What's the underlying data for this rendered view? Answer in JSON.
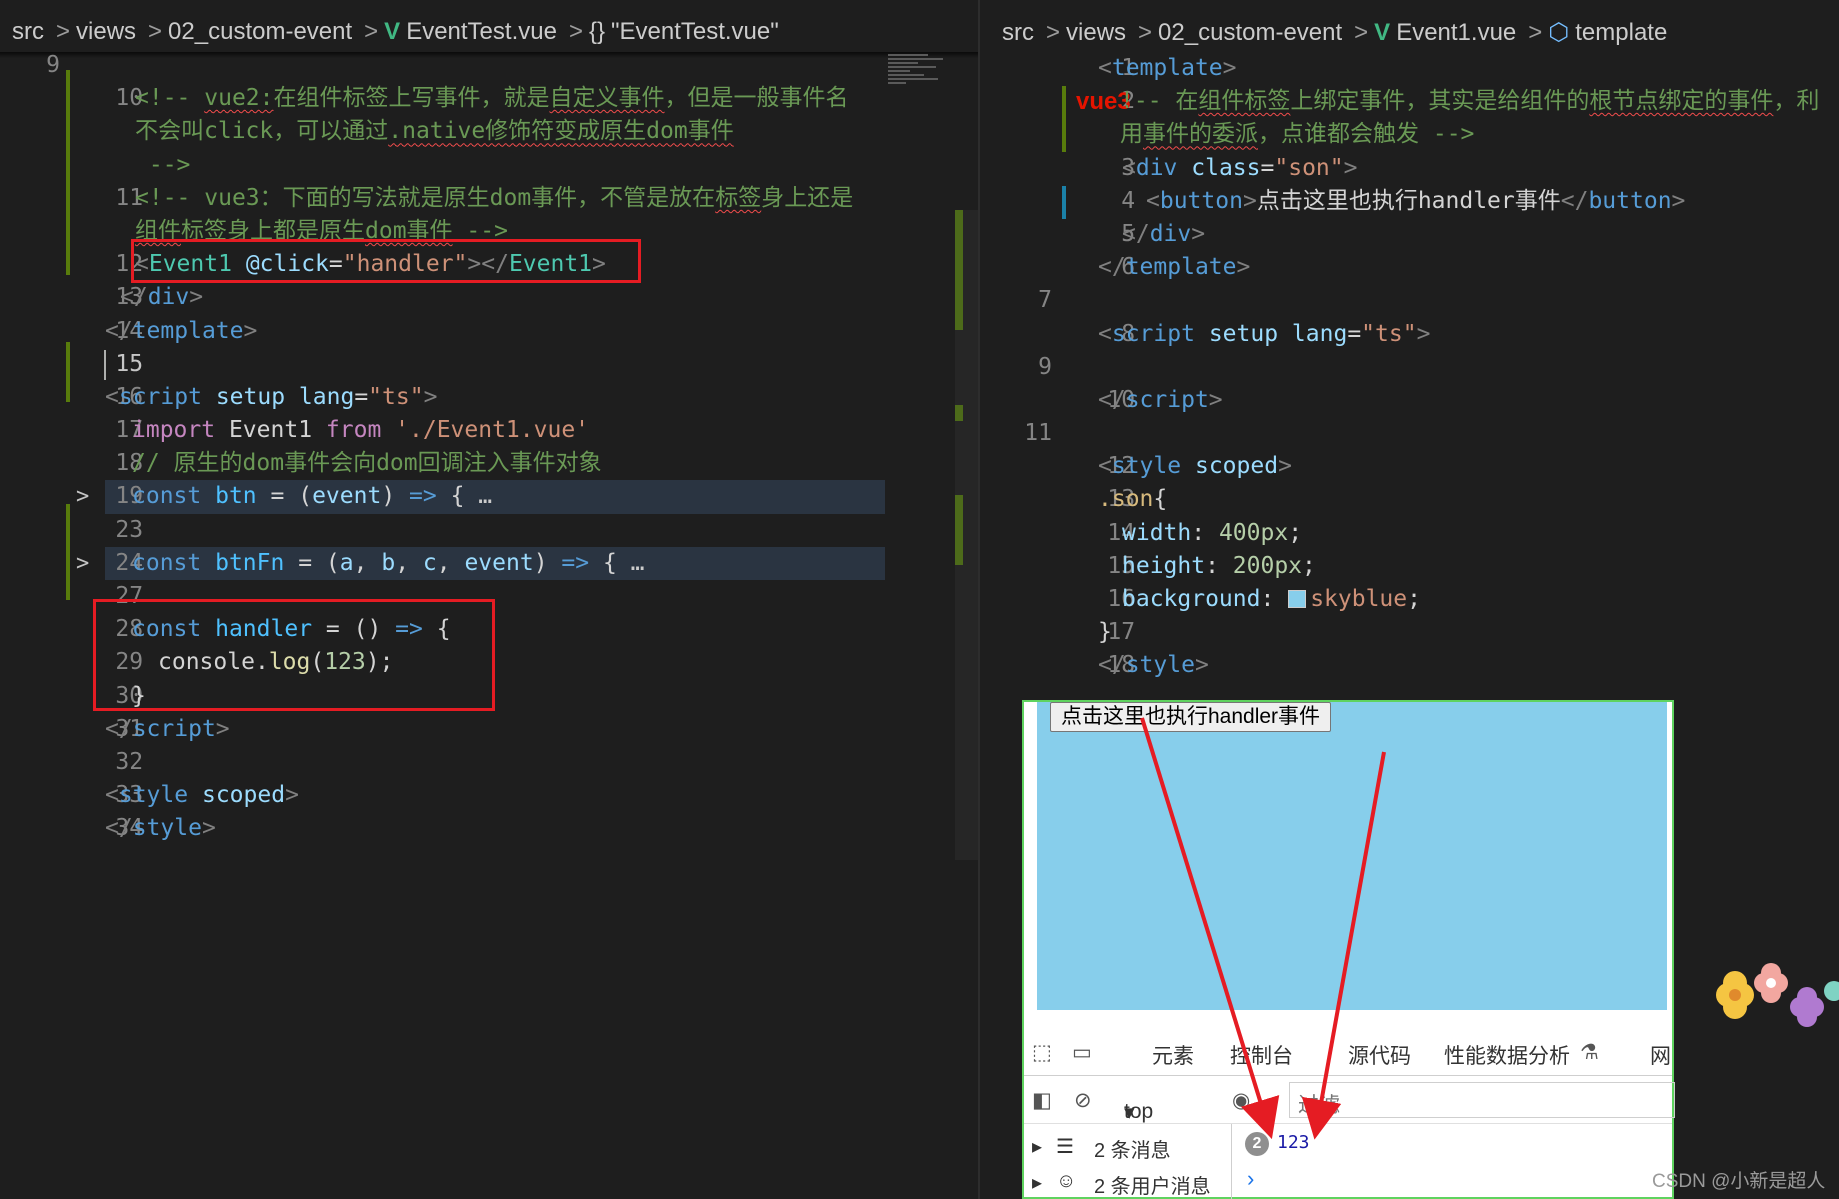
{
  "left_editor": {
    "breadcrumb": [
      "src",
      "views",
      "02_custom-event",
      "EventTest.vue",
      "\"EventTest.vue\""
    ],
    "line_numbers": {
      "l9": "9",
      "l10": "10",
      "l11": "11",
      "l12": "12",
      "l13": "13",
      "l14": "14",
      "l15": "15",
      "l16": "16",
      "l17": "17",
      "l18": "18",
      "l19": "19",
      "l23": "23",
      "l24": "24",
      "l27": "27",
      "l28": "28",
      "l29": "29",
      "l30": "30",
      "l31": "31",
      "l32": "32",
      "l33": "33",
      "l34": "34"
    },
    "code": {
      "l10_a": "<!-- ",
      "l10_b": "vue2:",
      "l10_c": "在组件标签上写事件，就是",
      "l10_d": "自定义事件",
      "l10_e": "，但是一般事件名不会叫click，可以通过",
      "l10_f": ".native修饰符变成原生dom事件",
      "l10_g": " -->",
      "l11_a": "<!-- ",
      "l11_b": "vue3",
      "l11_c": "：下面的写法就是原生dom事件，不管是放在",
      "l11_d": "标签",
      "l11_e": "身上还是",
      "l11_f": "组件",
      "l11_g": "标签身上都是原生",
      "l11_h": "dom事件",
      "l11_i": " -->",
      "l12_comp": "Event1",
      "l12_attr": "@click",
      "l12_val": "\"handler\"",
      "l12_close": "Event1",
      "l13": "div",
      "l14": "template",
      "l16_tag": "script",
      "l16_a1": "setup",
      "l16_a2": "lang",
      "l16_v2": "\"ts\"",
      "l17_kw": "import",
      "l17_id": "Event1",
      "l17_from": "from",
      "l17_str": "'./Event1.vue'",
      "l18": "// 原生的dom事件会向dom回调注入事件对象",
      "l19_kw": "const",
      "l19_id": "btn",
      "l19_param": "event",
      "l24_kw": "const",
      "l24_id": "btnFn",
      "l24_p1": "a",
      "l24_p2": "b",
      "l24_p3": "c",
      "l24_p4": "event",
      "l28_kw": "const",
      "l28_id": "handler",
      "l29_obj": "console",
      "l29_fn": "log",
      "l29_num": "123",
      "l31": "script",
      "l33_tag": "style",
      "l33_attr": "scoped",
      "l34": "style",
      "ellipsis": "…"
    }
  },
  "right_editor": {
    "breadcrumb": [
      "src",
      "views",
      "02_custom-event",
      "Event1.vue",
      "template"
    ],
    "line_numbers": {
      "l1": "1",
      "l2": "2",
      "l3": "3",
      "l4": "4",
      "l5": "5",
      "l6": "6",
      "l7": "7",
      "l8": "8",
      "l9": "9",
      "l10": "10",
      "l11": "11",
      "l12": "12",
      "l13": "13",
      "l14": "14",
      "l15": "15",
      "l16": "16",
      "l17": "17",
      "l18": "18"
    },
    "annotation": "vue3",
    "code": {
      "l1": "template",
      "l2_a": "!-- 在",
      "l2_b": "组件标签",
      "l2_c": "上绑定事件，其实是给组件的",
      "l2_d": "根节点绑定的事件",
      "l2_e": "，利用",
      "l2_f": "事件的委派",
      "l2_g": "，点谁都会触发 -->",
      "l3_tag": "div",
      "l3_attr": "class",
      "l3_val": "\"son\"",
      "l4_tag": "button",
      "l4_text": "点击这里也执行handler事件",
      "l5": "div",
      "l6": "template",
      "l8_tag": "script",
      "l8_a1": "setup",
      "l8_a2": "lang",
      "l8_v": "\"ts\"",
      "l10": "script",
      "l12_tag": "style",
      "l12_attr": "scoped",
      "l13": ".son",
      "l14_prop": "width",
      "l14_val": "400px",
      "l15_prop": "height",
      "l15_val": "200px",
      "l16_prop": "background",
      "l16_val": "skyblue",
      "l17": "}",
      "l18": "style"
    }
  },
  "preview": {
    "button_label": "点击这里也执行handler事件",
    "devtools_tabs": [
      "元素",
      "控制台",
      "源代码",
      "性能数据分析",
      "网"
    ],
    "context_select": "top",
    "filter_placeholder": "过滤",
    "sidebar": [
      "2 条消息",
      "2 条用户消息"
    ],
    "message_count": "2",
    "log_value": "123",
    "prompt": "›"
  },
  "watermark": "CSDN @小新是超人",
  "colors": {
    "son_background": "#87ceeb",
    "highlight": "#e51c23",
    "vue_green": "#41b883"
  }
}
